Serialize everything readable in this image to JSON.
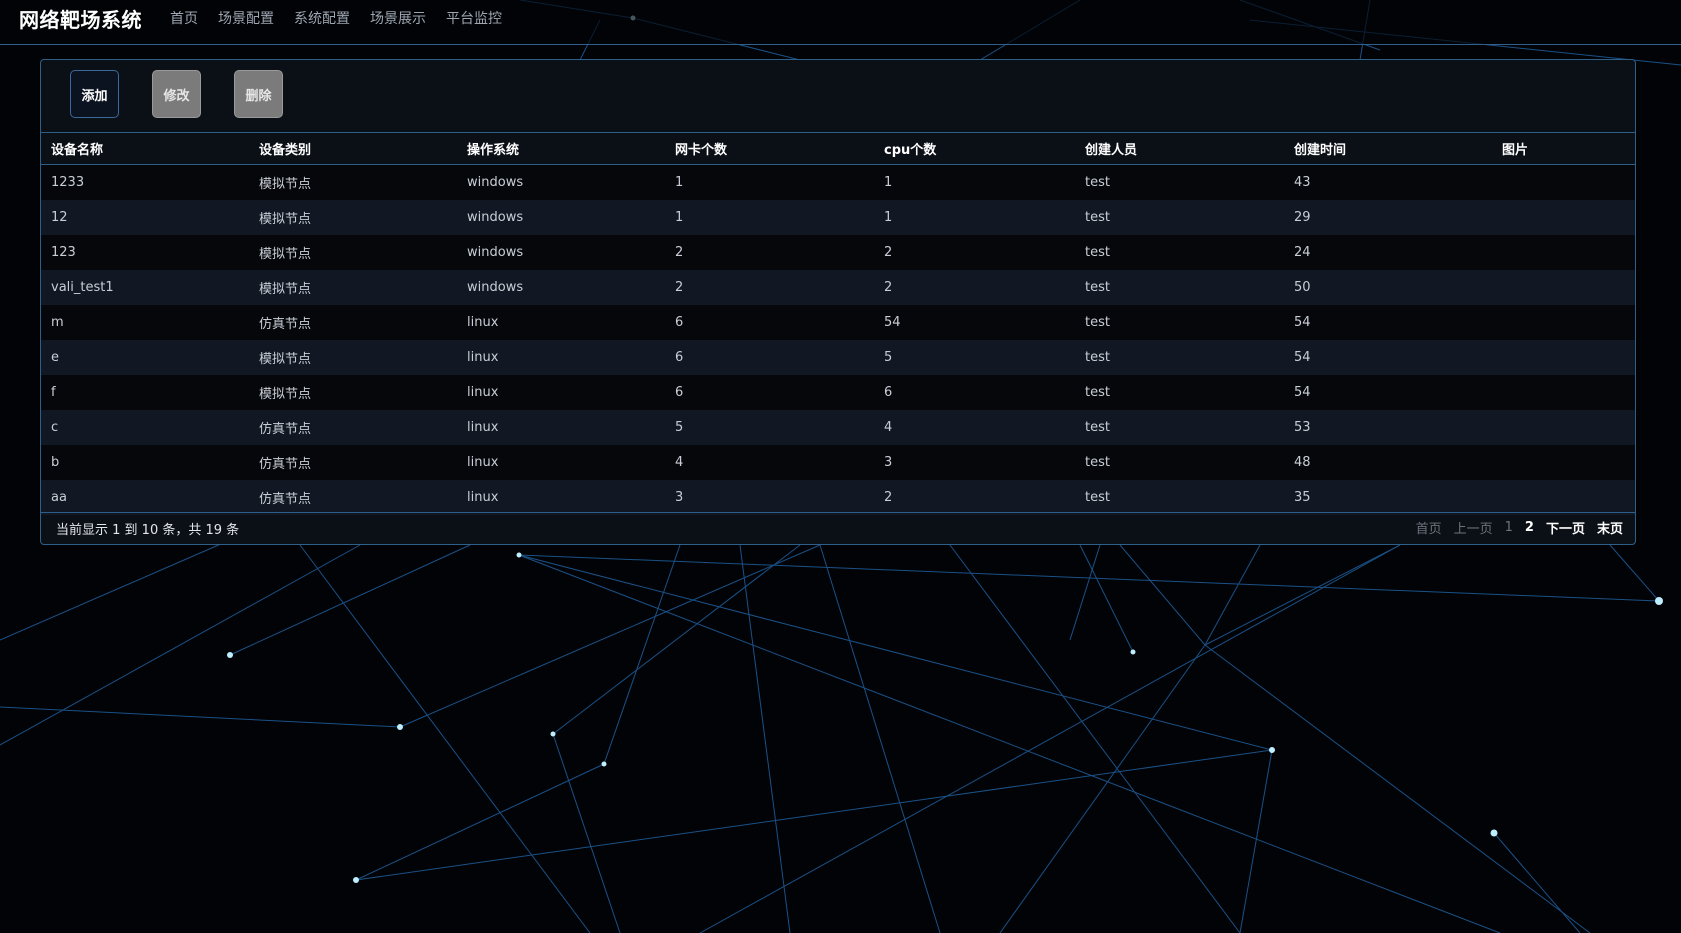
{
  "header": {
    "brand": "网络靶场系统",
    "nav": [
      "首页",
      "场景配置",
      "系统配置",
      "场景展示",
      "平台监控"
    ]
  },
  "toolbar": {
    "add_label": "添加",
    "edit_label": "修改",
    "delete_label": "删除"
  },
  "table": {
    "columns": [
      "设备名称",
      "设备类别",
      "操作系统",
      "网卡个数",
      "cpu个数",
      "创建人员",
      "创建时间",
      "图片"
    ],
    "rows": [
      [
        "1233",
        "模拟节点",
        "windows",
        "1",
        "1",
        "test",
        "43",
        ""
      ],
      [
        "12",
        "模拟节点",
        "windows",
        "1",
        "1",
        "test",
        "29",
        ""
      ],
      [
        "123",
        "模拟节点",
        "windows",
        "2",
        "2",
        "test",
        "24",
        ""
      ],
      [
        "vali_test1",
        "模拟节点",
        "windows",
        "2",
        "2",
        "test",
        "50",
        ""
      ],
      [
        "m",
        "仿真节点",
        "linux",
        "6",
        "54",
        "test",
        "54",
        ""
      ],
      [
        "e",
        "模拟节点",
        "linux",
        "6",
        "5",
        "test",
        "54",
        ""
      ],
      [
        "f",
        "模拟节点",
        "linux",
        "6",
        "6",
        "test",
        "54",
        ""
      ],
      [
        "c",
        "仿真节点",
        "linux",
        "5",
        "4",
        "test",
        "53",
        ""
      ],
      [
        "b",
        "仿真节点",
        "linux",
        "4",
        "3",
        "test",
        "48",
        ""
      ],
      [
        "aa",
        "仿真节点",
        "linux",
        "3",
        "2",
        "test",
        "35",
        ""
      ]
    ]
  },
  "footer": {
    "summary": "当前显示 1 到 10 条，共 19 条",
    "first": "首页",
    "prev": "上一页",
    "page1": "1",
    "page2": "2",
    "next": "下一页",
    "last": "末页"
  },
  "colors": {
    "background": "#020306",
    "accent_line": "#2e5f89",
    "network_line": "#1f5f9e",
    "network_node": "#bfefff"
  }
}
